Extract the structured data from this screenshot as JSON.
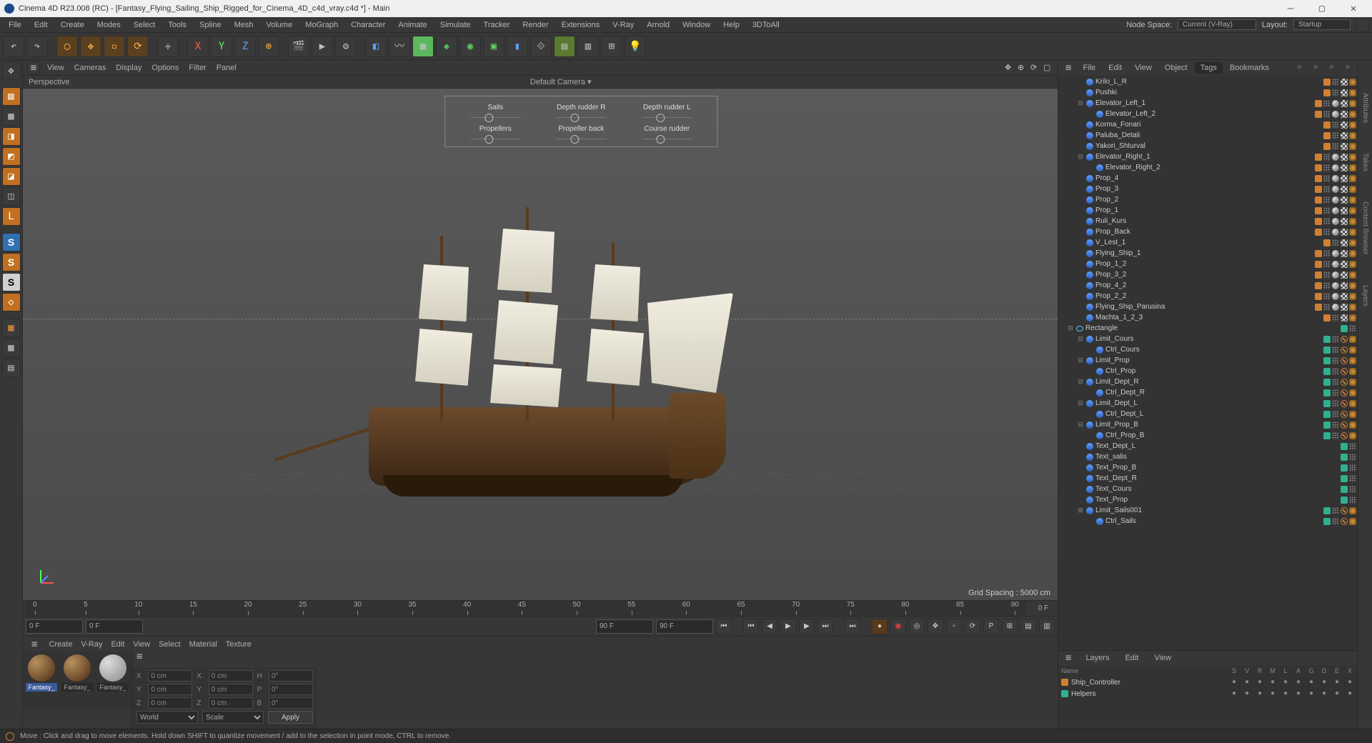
{
  "title": "Cinema 4D R23.008 (RC) - [Fantasy_Flying_Sailing_Ship_Rigged_for_Cinema_4D_c4d_vray.c4d *] - Main",
  "menu": [
    "File",
    "Edit",
    "Create",
    "Modes",
    "Select",
    "Tools",
    "Spline",
    "Mesh",
    "Volume",
    "MoGraph",
    "Character",
    "Animate",
    "Simulate",
    "Tracker",
    "Render",
    "Extensions",
    "V-Ray",
    "Arnold",
    "Window",
    "Help",
    "3DToAll"
  ],
  "node_space_label": "Node Space:",
  "node_space_value": "Current (V-Ray)",
  "layout_label": "Layout:",
  "layout_value": "Startup",
  "viewport_menu": [
    "View",
    "Cameras",
    "Display",
    "Options",
    "Filter",
    "Panel"
  ],
  "viewport": {
    "perspective": "Perspective",
    "camera": "Default Camera",
    "grid_spacing": "Grid Spacing : 5000 cm"
  },
  "hud": [
    {
      "label": "Sails"
    },
    {
      "label": "Depth rudder R"
    },
    {
      "label": "Depth rudder L"
    },
    {
      "label": "Propellers"
    },
    {
      "label": "Propeller back"
    },
    {
      "label": "Course rudder"
    }
  ],
  "timeline": {
    "ticks": [
      "0",
      "5",
      "10",
      "15",
      "20",
      "25",
      "30",
      "35",
      "40",
      "45",
      "50",
      "55",
      "60",
      "65",
      "70",
      "75",
      "80",
      "85",
      "90"
    ],
    "right_label": "0 F",
    "start": "0 F",
    "start2": "0 F",
    "end": "90 F",
    "end2": "90 F"
  },
  "mat_menu": [
    "Create",
    "V-Ray",
    "Edit",
    "View",
    "Select",
    "Material",
    "Texture"
  ],
  "materials": [
    {
      "name": "Fantasy_",
      "sel": true
    },
    {
      "name": "Fantasy_",
      "sel": false
    },
    {
      "name": "Fantasy_",
      "sel": false,
      "grey": true
    }
  ],
  "coords": {
    "x": "0 cm",
    "y": "0 cm",
    "z": "0 cm",
    "x2": "0 cm",
    "y2": "0 cm",
    "z2": "0 cm",
    "h": "0°",
    "p": "0°",
    "b": "0°",
    "mode1": "World",
    "mode2": "Scale",
    "apply": "Apply"
  },
  "obj_tabs": [
    "File",
    "Edit",
    "View",
    "Object",
    "Tags",
    "Bookmarks"
  ],
  "obj_tabs_active": "Tags",
  "tree": [
    {
      "i": 1,
      "exp": "",
      "name": "Krilo_L_R",
      "tags": [
        "layer-orange",
        "dots",
        "check",
        "vray"
      ],
      "t": "null"
    },
    {
      "i": 1,
      "exp": "",
      "name": "Pushki",
      "tags": [
        "layer-orange",
        "dots",
        "check",
        "vray"
      ],
      "t": "null"
    },
    {
      "i": 1,
      "exp": "-",
      "name": "Elevator_Left_1",
      "tags": [
        "layer-orange",
        "dots",
        "sphere",
        "check",
        "vray"
      ],
      "t": "null"
    },
    {
      "i": 2,
      "exp": "",
      "name": "Elevator_Left_2",
      "tags": [
        "layer-orange",
        "dots",
        "sphere",
        "check",
        "vray"
      ],
      "t": "null"
    },
    {
      "i": 1,
      "exp": "",
      "name": "Korma_Fonari",
      "tags": [
        "layer-orange",
        "dots",
        "check",
        "vray"
      ],
      "t": "null"
    },
    {
      "i": 1,
      "exp": "",
      "name": "Paluba_Detali",
      "tags": [
        "layer-orange",
        "dots",
        "check",
        "vray"
      ],
      "t": "null"
    },
    {
      "i": 1,
      "exp": "",
      "name": "Yakori_Shturval",
      "tags": [
        "layer-orange",
        "dots",
        "check",
        "vray"
      ],
      "t": "null"
    },
    {
      "i": 1,
      "exp": "-",
      "name": "Elevator_Right_1",
      "tags": [
        "layer-orange",
        "dots",
        "sphere",
        "check",
        "vray"
      ],
      "t": "null"
    },
    {
      "i": 2,
      "exp": "",
      "name": "Elevator_Right_2",
      "tags": [
        "layer-orange",
        "dots",
        "sphere",
        "check",
        "vray"
      ],
      "t": "null"
    },
    {
      "i": 1,
      "exp": "",
      "name": "Prop_4",
      "tags": [
        "layer-orange",
        "dots",
        "sphere",
        "check",
        "vray"
      ],
      "t": "null"
    },
    {
      "i": 1,
      "exp": "",
      "name": "Prop_3",
      "tags": [
        "layer-orange",
        "dots",
        "sphere",
        "check",
        "vray"
      ],
      "t": "null"
    },
    {
      "i": 1,
      "exp": "",
      "name": "Prop_2",
      "tags": [
        "layer-orange",
        "dots",
        "sphere",
        "check",
        "vray"
      ],
      "t": "null"
    },
    {
      "i": 1,
      "exp": "",
      "name": "Prop_1",
      "tags": [
        "layer-orange",
        "dots",
        "sphere",
        "check",
        "vray"
      ],
      "t": "null"
    },
    {
      "i": 1,
      "exp": "",
      "name": "Ruli_Kurs",
      "tags": [
        "layer-orange",
        "dots",
        "sphere",
        "check",
        "vray"
      ],
      "t": "null"
    },
    {
      "i": 1,
      "exp": "",
      "name": "Prop_Back",
      "tags": [
        "layer-orange",
        "dots",
        "sphere",
        "check",
        "vray"
      ],
      "t": "null"
    },
    {
      "i": 1,
      "exp": "",
      "name": "V_Lest_1",
      "tags": [
        "layer-orange",
        "dots",
        "check",
        "vray"
      ],
      "t": "null"
    },
    {
      "i": 1,
      "exp": "",
      "name": "Flying_Ship_1",
      "tags": [
        "layer-orange",
        "dots",
        "sphere",
        "check",
        "vray"
      ],
      "t": "null"
    },
    {
      "i": 1,
      "exp": "",
      "name": "Prop_1_2",
      "tags": [
        "layer-orange",
        "dots",
        "sphere",
        "check",
        "vray"
      ],
      "t": "null"
    },
    {
      "i": 1,
      "exp": "",
      "name": "Prop_3_2",
      "tags": [
        "layer-orange",
        "dots",
        "sphere",
        "check",
        "vray"
      ],
      "t": "null"
    },
    {
      "i": 1,
      "exp": "",
      "name": "Prop_4_2",
      "tags": [
        "layer-orange",
        "dots",
        "sphere",
        "check",
        "vray"
      ],
      "t": "null"
    },
    {
      "i": 1,
      "exp": "",
      "name": "Prop_2_2",
      "tags": [
        "layer-orange",
        "dots",
        "sphere",
        "check",
        "vray"
      ],
      "t": "null"
    },
    {
      "i": 1,
      "exp": "",
      "name": "Flying_Ship_Parusina",
      "tags": [
        "layer-orange",
        "dots",
        "sphere",
        "check",
        "vray"
      ],
      "t": "null"
    },
    {
      "i": 1,
      "exp": "",
      "name": "Machta_1_2_3",
      "tags": [
        "layer-orange",
        "dots",
        "check",
        "vray"
      ],
      "t": "null"
    },
    {
      "i": 0,
      "exp": "-",
      "name": "Rectangle",
      "tags": [
        "layer-teal",
        "dots"
      ],
      "t": "rect"
    },
    {
      "i": 1,
      "exp": "-",
      "name": "Limit_Cours",
      "tags": [
        "layer-teal",
        "dots",
        "stop",
        "vray"
      ],
      "t": "null"
    },
    {
      "i": 2,
      "exp": "",
      "name": "Ctrl_Cours",
      "tags": [
        "layer-teal",
        "dots",
        "stop",
        "vray"
      ],
      "t": "null"
    },
    {
      "i": 1,
      "exp": "-",
      "name": "Limit_Prop",
      "tags": [
        "layer-teal",
        "dots",
        "stop",
        "vray"
      ],
      "t": "null"
    },
    {
      "i": 2,
      "exp": "",
      "name": "Ctrl_Prop",
      "tags": [
        "layer-teal",
        "dots",
        "stop",
        "vray"
      ],
      "t": "null"
    },
    {
      "i": 1,
      "exp": "-",
      "name": "Limit_Dept_R",
      "tags": [
        "layer-teal",
        "dots",
        "stop",
        "vray"
      ],
      "t": "null"
    },
    {
      "i": 2,
      "exp": "",
      "name": "Ctrl_Dept_R",
      "tags": [
        "layer-teal",
        "dots",
        "stop",
        "vray"
      ],
      "t": "null"
    },
    {
      "i": 1,
      "exp": "-",
      "name": "Limit_Dept_L",
      "tags": [
        "layer-teal",
        "dots",
        "stop",
        "vray"
      ],
      "t": "null"
    },
    {
      "i": 2,
      "exp": "",
      "name": "Ctrl_Dept_L",
      "tags": [
        "layer-teal",
        "dots",
        "stop",
        "vray"
      ],
      "t": "null"
    },
    {
      "i": 1,
      "exp": "-",
      "name": "Limit_Prop_B",
      "tags": [
        "layer-teal",
        "dots",
        "stop",
        "vray"
      ],
      "t": "null"
    },
    {
      "i": 2,
      "exp": "",
      "name": "Ctrl_Prop_B",
      "tags": [
        "layer-teal",
        "dots",
        "stop",
        "vray"
      ],
      "t": "null"
    },
    {
      "i": 1,
      "exp": "",
      "name": "Text_Dept_L",
      "tags": [
        "layer-teal",
        "dots"
      ],
      "t": "null"
    },
    {
      "i": 1,
      "exp": "",
      "name": "Text_salis",
      "tags": [
        "layer-teal",
        "dots"
      ],
      "t": "null"
    },
    {
      "i": 1,
      "exp": "",
      "name": "Text_Prop_B",
      "tags": [
        "layer-teal",
        "dots"
      ],
      "t": "null"
    },
    {
      "i": 1,
      "exp": "",
      "name": "Text_Dept_R",
      "tags": [
        "layer-teal",
        "dots"
      ],
      "t": "null"
    },
    {
      "i": 1,
      "exp": "",
      "name": "Text_Cours",
      "tags": [
        "layer-teal",
        "dots"
      ],
      "t": "null"
    },
    {
      "i": 1,
      "exp": "",
      "name": "Text_Prop",
      "tags": [
        "layer-teal",
        "dots"
      ],
      "t": "null"
    },
    {
      "i": 1,
      "exp": "+",
      "name": "Limit_Sails001",
      "tags": [
        "layer-teal",
        "dots",
        "stop",
        "vray"
      ],
      "t": "null"
    },
    {
      "i": 2,
      "exp": "",
      "name": "Ctrl_Sails",
      "tags": [
        "layer-teal",
        "dots",
        "stop",
        "vray"
      ],
      "t": "null"
    }
  ],
  "layers_tabs": [
    "Layers",
    "Edit",
    "View"
  ],
  "layers_cols": [
    "Name",
    "S",
    "V",
    "R",
    "M",
    "L",
    "A",
    "G",
    "D",
    "E",
    "X"
  ],
  "layers": [
    {
      "color": "#d08030",
      "name": "Ship_Controller"
    },
    {
      "color": "#30b090",
      "name": "Helpers"
    }
  ],
  "vtabs": [
    "Attributes",
    "Takes",
    "Content Browser",
    "Layers"
  ],
  "status": "Move : Click and drag to move elements. Hold down SHIFT to quantize movement / add to the selection in point mode, CTRL to remove."
}
